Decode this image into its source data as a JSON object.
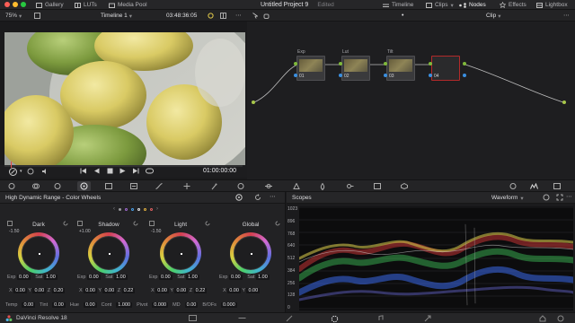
{
  "topbar": {
    "tabs": [
      {
        "label": "Gallery",
        "icon": "gallery-icon"
      },
      {
        "label": "LUTs",
        "icon": "luts-icon"
      },
      {
        "label": "Media Pool",
        "icon": "media-pool-icon"
      }
    ],
    "project_title": "Untitled Project 9",
    "edited_label": "Edited",
    "right_tabs": [
      {
        "label": "Timeline",
        "icon": "timeline-icon"
      },
      {
        "label": "Clips",
        "icon": "clips-icon"
      },
      {
        "label": "Nodes",
        "icon": "nodes-icon"
      },
      {
        "label": "Effects",
        "icon": "effects-icon"
      },
      {
        "label": "Lightbox",
        "icon": "lightbox-icon"
      }
    ],
    "traffic_colors": [
      "#ff5f57",
      "#febc2e",
      "#28c840"
    ]
  },
  "viewer": {
    "zoom": "75%",
    "timeline_name": "Timeline 1",
    "timecode": "03:48:36:05",
    "clip_mode": "Clip",
    "playhead_timecode": "01:00:00:00"
  },
  "nodes": {
    "items": [
      {
        "label": "Exp",
        "num": "01"
      },
      {
        "label": "Lut",
        "num": "02"
      },
      {
        "label": "Tilt",
        "num": "03"
      },
      {
        "label": "",
        "num": "04"
      }
    ],
    "colors": {
      "rgb_pin": "#7fb93a",
      "selected_border": "#b32a2a",
      "link": "#bdbdbd",
      "blue_pin": "#3a8fe0"
    }
  },
  "color_wheels": {
    "panel_title": "High Dynamic Range - Color Wheels",
    "page_dots": 6,
    "wheels": [
      {
        "name": "Dark",
        "value": "-1.50",
        "exp": "0.00",
        "sat": "1.00",
        "x": "0.00",
        "y": "0.00",
        "z": "0.20"
      },
      {
        "name": "Shadow",
        "value": "+1.00",
        "exp": "0.00",
        "sat": "1.00",
        "x": "0.00",
        "y": "0.00",
        "z": "0.22"
      },
      {
        "name": "Light",
        "value": "-1.50",
        "exp": "0.00",
        "sat": "1.00",
        "x": "0.00",
        "y": "0.00",
        "z": "0.22"
      },
      {
        "name": "Global",
        "value": "",
        "exp": "0.00",
        "sat": "1.00",
        "x": "0.00",
        "y": "0.00",
        "z": ""
      }
    ],
    "labels": {
      "exp": "Exp",
      "sat": "Sat",
      "x": "X",
      "y": "Y",
      "z": "Z"
    },
    "bottom_params": [
      {
        "label": "Temp",
        "value": "0.00"
      },
      {
        "label": "Tint",
        "value": "0.00"
      },
      {
        "label": "Hue",
        "value": "0.00"
      },
      {
        "label": "Cont",
        "value": "1.000"
      },
      {
        "label": "Pivot",
        "value": "0.000"
      },
      {
        "label": "MD",
        "value": "0.00"
      },
      {
        "label": "B/OFs",
        "value": "0.000"
      }
    ]
  },
  "scopes": {
    "panel_title": "Scopes",
    "mode": "Waveform",
    "ticks": [
      "1023",
      "896",
      "768",
      "640",
      "512",
      "384",
      "256",
      "128",
      "0"
    ]
  },
  "bottombar": {
    "app_name": "DaVinci Resolve 18"
  }
}
